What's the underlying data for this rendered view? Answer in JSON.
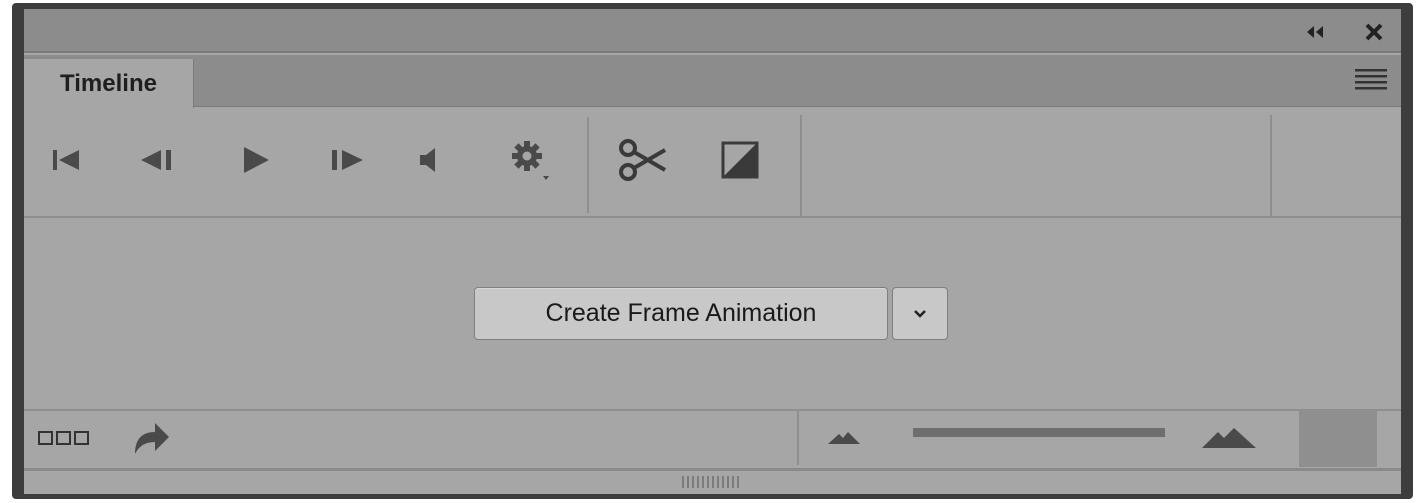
{
  "panel": {
    "tab_label": "Timeline",
    "title_controls": [
      "collapse-icon",
      "close-icon"
    ],
    "menu_icon": "panel-menu-icon"
  },
  "toolbar": {
    "buttons": [
      "go-to-first-frame-icon",
      "previous-frame-icon",
      "play-icon",
      "next-frame-icon",
      "audio-icon",
      "settings-gear-icon",
      "split-scissors-icon",
      "transition-icon"
    ]
  },
  "main": {
    "create_button_label": "Create Frame Animation",
    "dropdown_icon": "chevron-down-icon"
  },
  "bottom": {
    "left_icons": [
      "frames-icon",
      "convert-arrow-icon"
    ],
    "zoom": {
      "min_icon": "zoom-out-mountain-icon",
      "max_icon": "zoom-in-mountain-icon"
    }
  },
  "colors": {
    "panel_bg": "#a6a6a6",
    "header_bg": "#8c8c8c",
    "border": "#3d3d3d",
    "icon": "#4a4a4a",
    "button_bg": "#c8c8c8"
  }
}
